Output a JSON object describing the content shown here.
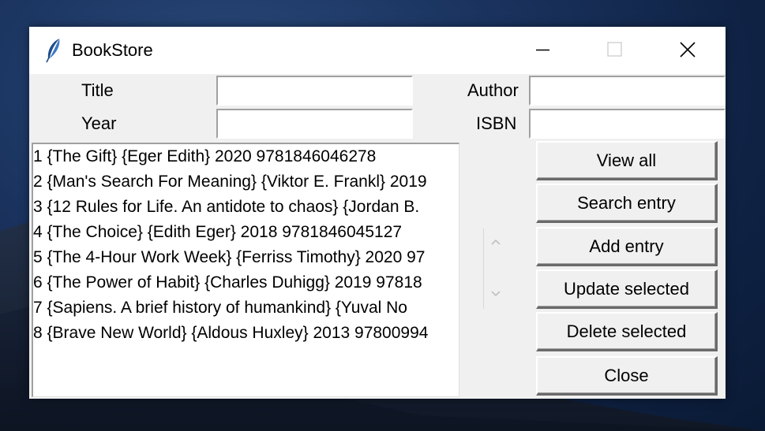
{
  "window": {
    "title": "BookStore",
    "controls": [
      "minimize-icon",
      "maximize-icon",
      "close-icon"
    ]
  },
  "form": {
    "title_label": "Title",
    "title_value": "",
    "author_label": "Author",
    "author_value": "",
    "year_label": "Year",
    "year_value": "",
    "isbn_label": "ISBN",
    "isbn_value": ""
  },
  "list": {
    "rows": [
      "1 {The Gift} {Eger Edith} 2020 9781846046278",
      "2 {Man's Search For Meaning} {Viktor E. Frankl} 2019",
      "3 {12 Rules for Life. An antidote to chaos} {Jordan B.",
      "4 {The Choice} {Edith Eger} 2018 9781846045127",
      "5 {The 4-Hour Work Week} {Ferriss Timothy} 2020 97",
      "6 {The Power of Habit} {Charles Duhigg} 2019 97818",
      "7 {Sapiens. A brief history of humankind} {Yuval No",
      "8 {Brave New World} {Aldous Huxley} 2013 97800994"
    ]
  },
  "buttons": {
    "view_all": "View all",
    "search_entry": "Search entry",
    "add_entry": "Add entry",
    "update_selected": "Update selected",
    "delete_selected": "Delete selected",
    "close": "Close"
  },
  "colors": {
    "window_bg": "#f0f0f0",
    "titlebar_bg": "#ffffff",
    "icon_blue": "#1e4f8c"
  }
}
